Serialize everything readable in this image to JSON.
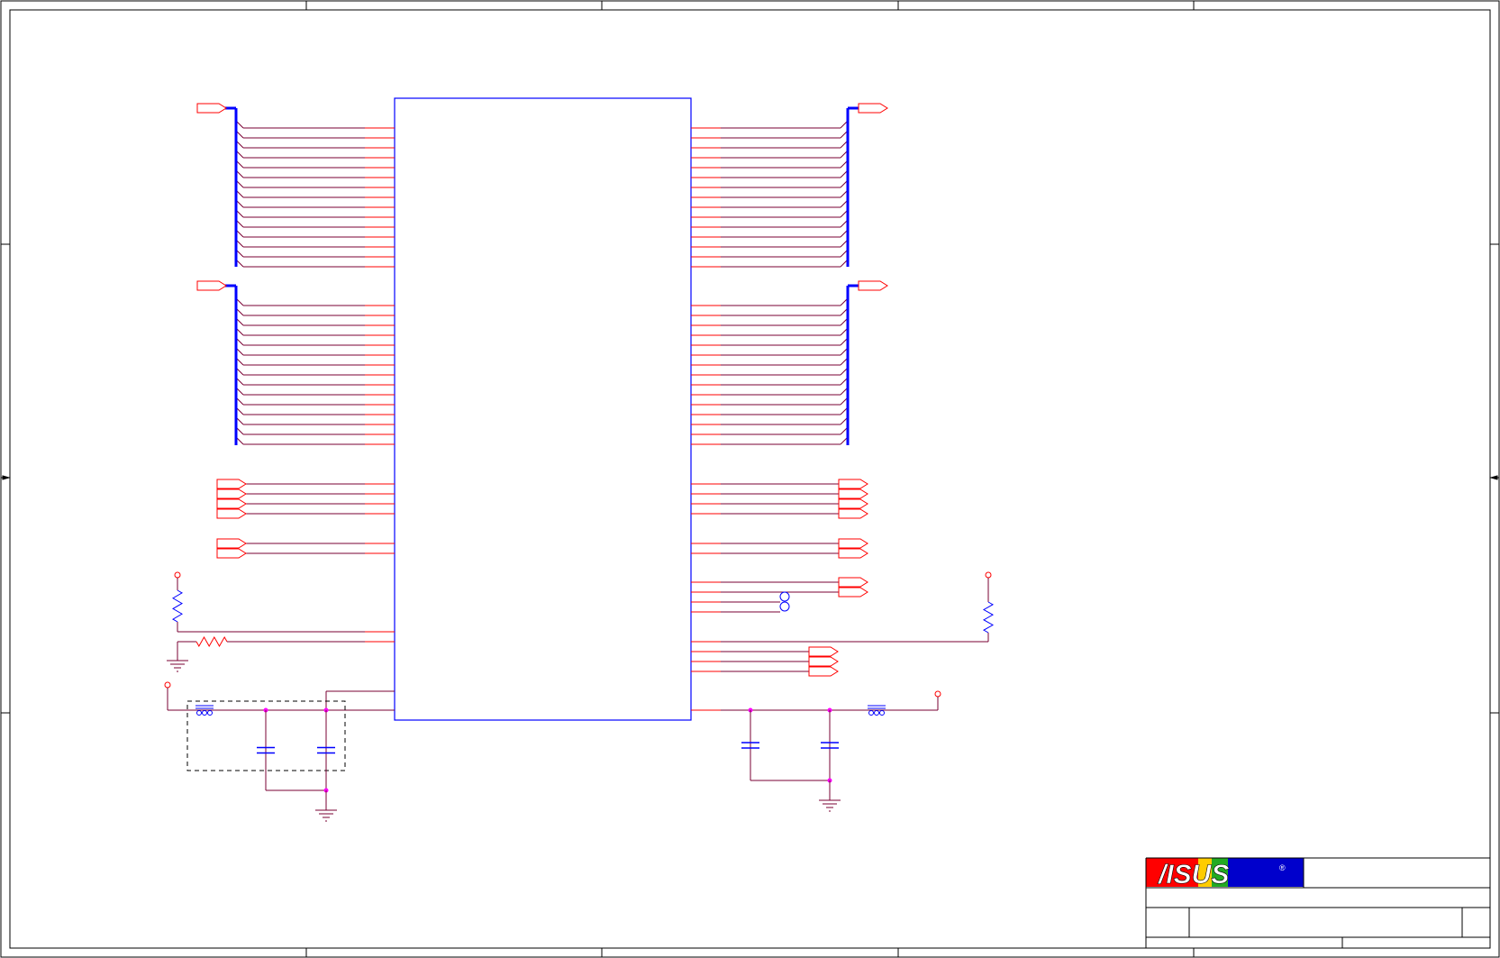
{
  "logo": {
    "text": "/ISUS",
    "registered": "®"
  },
  "colors": {
    "border": "#000000",
    "chip": "#0000ff",
    "wire": "#ff0000",
    "net": "#7a0033",
    "bus": "#0000ff",
    "junction": "#ff00ff",
    "port": "#ff0000",
    "logo_red": "#ff0000",
    "logo_blue": "#0000cc"
  },
  "icons": {
    "port": "offpage-connector-icon",
    "power": "power-pin-icon",
    "ground": "ground-icon",
    "resistor": "resistor-icon",
    "capacitor": "capacitor-icon",
    "ferrite": "ferrite-bead-icon",
    "testpoint": "test-point-icon",
    "logo": "asus-logo-icon"
  }
}
